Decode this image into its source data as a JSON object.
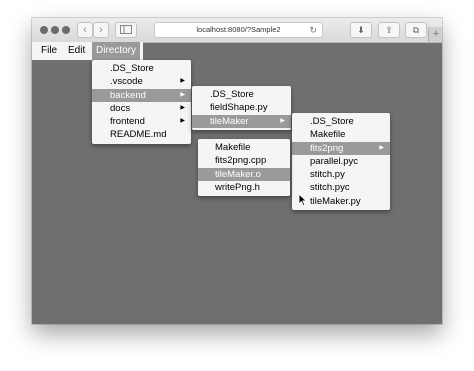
{
  "browser": {
    "url": "localhost:8080/?Sample2",
    "back_glyph": "‹",
    "forward_glyph": "›",
    "reload_glyph": "↻",
    "download_glyph": "⬇",
    "share_glyph": "⇪",
    "tabs_glyph": "⧉",
    "newtab_glyph": "+"
  },
  "menubar": {
    "file": "File",
    "edit": "Edit",
    "directory": "Directory"
  },
  "menus": {
    "root": [
      {
        "label": ".DS_Store"
      },
      {
        "label": ".vscode",
        "submenu": true
      },
      {
        "label": "backend",
        "submenu": true,
        "selected": true
      },
      {
        "label": "docs",
        "submenu": true
      },
      {
        "label": "frontend",
        "submenu": true
      },
      {
        "label": "README.md"
      }
    ],
    "backend": [
      {
        "label": ".DS_Store"
      },
      {
        "label": "fieldShape.py"
      },
      {
        "label": "tileMaker",
        "submenu": true,
        "selected": true
      }
    ],
    "tileMaker": [
      {
        "label": ".DS_Store"
      },
      {
        "label": "Makefile"
      },
      {
        "label": "fits2png",
        "submenu": true,
        "selected": true
      },
      {
        "label": "parallel.pyc"
      },
      {
        "label": "stitch.py"
      },
      {
        "label": "stitch.pyc"
      },
      {
        "label": "tileMaker.py"
      }
    ],
    "fits2png": [
      {
        "label": "Makefile"
      },
      {
        "label": "fits2png.cpp"
      },
      {
        "label": "tileMaker.o",
        "selected": true
      },
      {
        "label": "writePng.h"
      }
    ]
  },
  "colors": {
    "viewport": "#6f6f6f",
    "menu_bg": "#f5f5f5",
    "selection": "#9a9a9a"
  }
}
